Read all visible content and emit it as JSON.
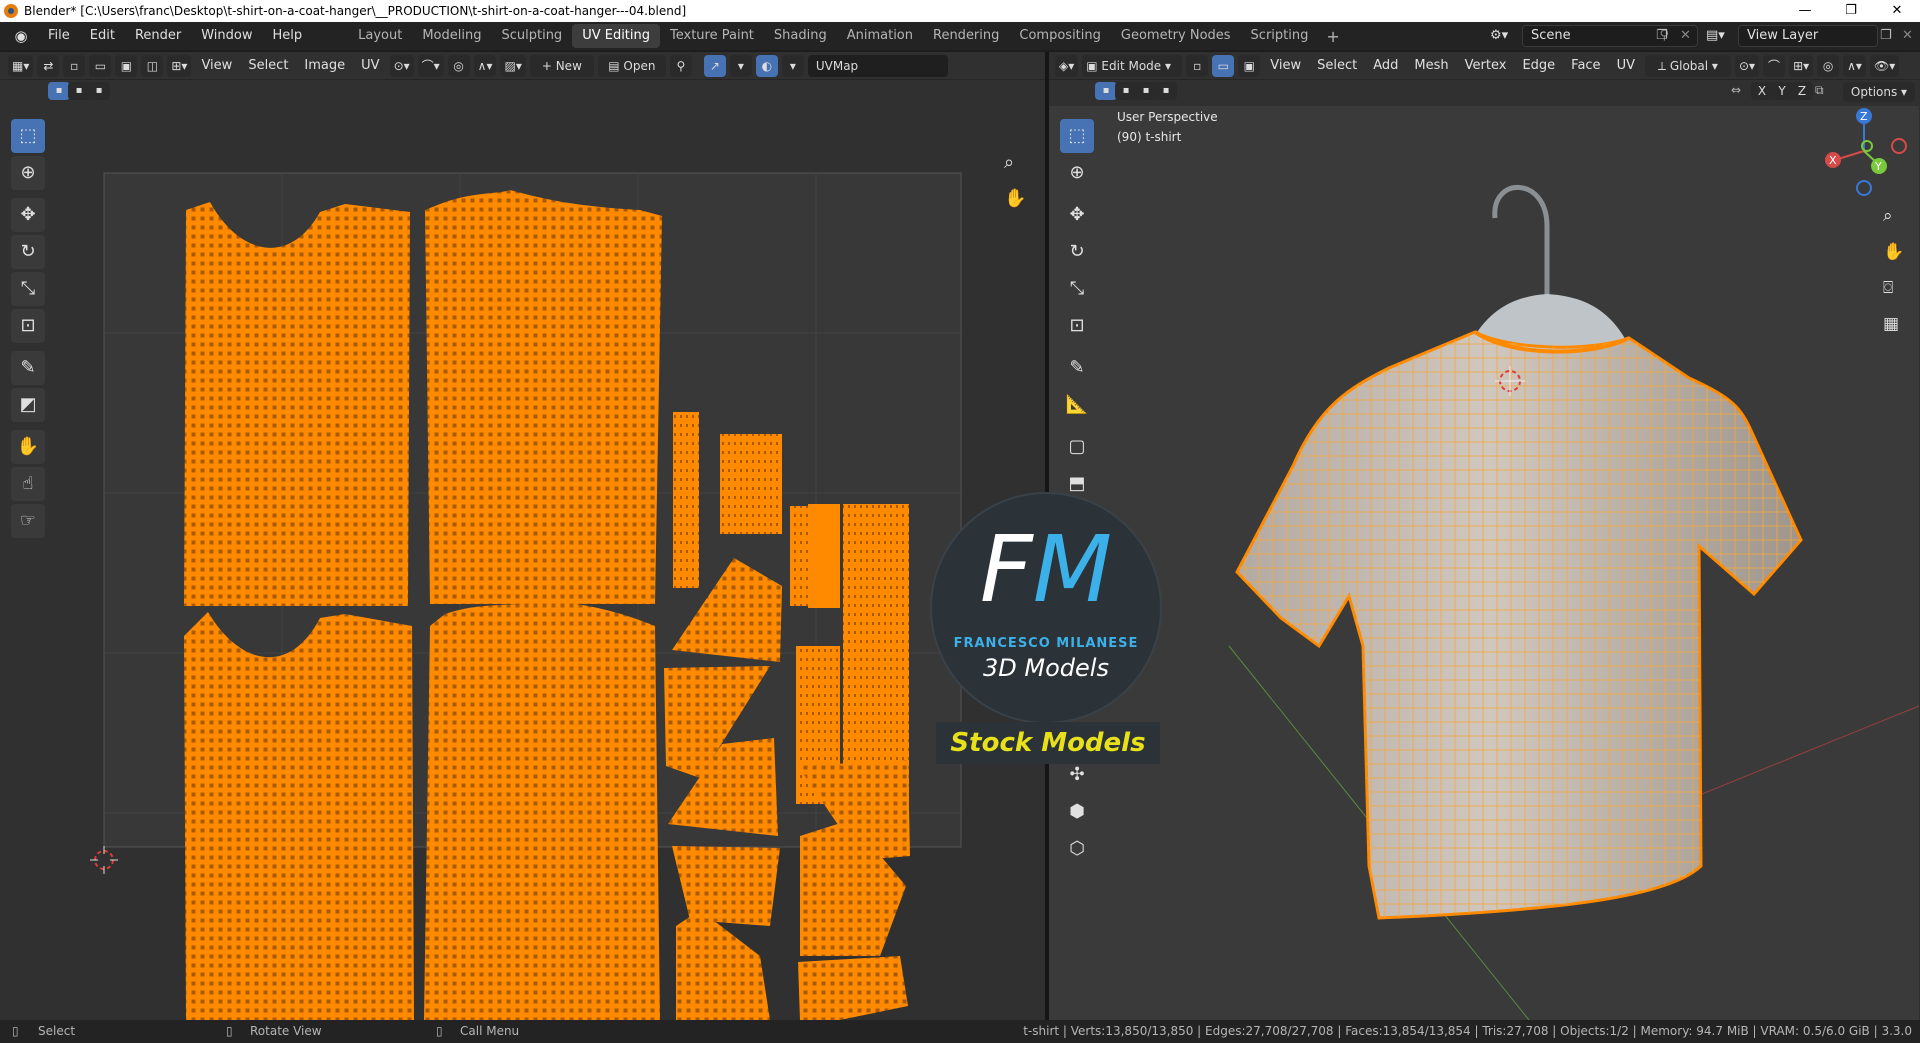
{
  "window": {
    "title": "Blender* [C:\\Users\\franc\\Desktop\\t-shirt-on-a-coat-hanger\\__PRODUCTION\\t-shirt-on-a-coat-hanger---04.blend]",
    "minimize": "—",
    "maximize": "❐",
    "close": "✕"
  },
  "menu": [
    "File",
    "Edit",
    "Render",
    "Window",
    "Help"
  ],
  "workspaces": [
    "Layout",
    "Modeling",
    "Sculpting",
    "UV Editing",
    "Texture Paint",
    "Shading",
    "Animation",
    "Rendering",
    "Compositing",
    "Geometry Nodes",
    "Scripting"
  ],
  "active_workspace": "UV Editing",
  "scene": {
    "label": "Scene",
    "view_layer": "View Layer"
  },
  "uv_editor": {
    "menus": [
      "View",
      "Select",
      "Image",
      "UV"
    ],
    "new_label": "New",
    "open_label": "Open",
    "uvmap": "UVMap"
  },
  "viewport": {
    "mode": "Edit Mode",
    "menus": [
      "View",
      "Select",
      "Add",
      "Mesh",
      "Vertex",
      "Edge",
      "Face",
      "UV"
    ],
    "orientation": "Global",
    "options": "Options",
    "axis_lock": [
      "X",
      "Y",
      "Z"
    ],
    "perspective": "User Perspective",
    "object_label": "(90) t-shirt",
    "gizmo": {
      "z": "Z",
      "y": "Y",
      "x": "X"
    }
  },
  "watermark": {
    "fm_f": "F",
    "fm_m": "M",
    "name": "FRANCESCO MILANESE",
    "sub": "3D Models",
    "banner": "Stock Models"
  },
  "status": {
    "select": "Select",
    "rotate": "Rotate View",
    "call_menu": "Call Menu",
    "stats": "t-shirt | Verts:13,850/13,850 | Edges:27,708/27,708 | Faces:13,854/13,854 | Tris:27,708 | Objects:1/2 | Memory: 94.7 MiB | VRAM: 0.5/6.0 GiB | 3.3.0"
  },
  "colors": {
    "accent": "#4772b3",
    "uv_orange": "#ff8a00",
    "wire_orange": "#f5a83a",
    "brand_blue": "#3cb0e8",
    "banner_yellow": "#e8e11a"
  }
}
